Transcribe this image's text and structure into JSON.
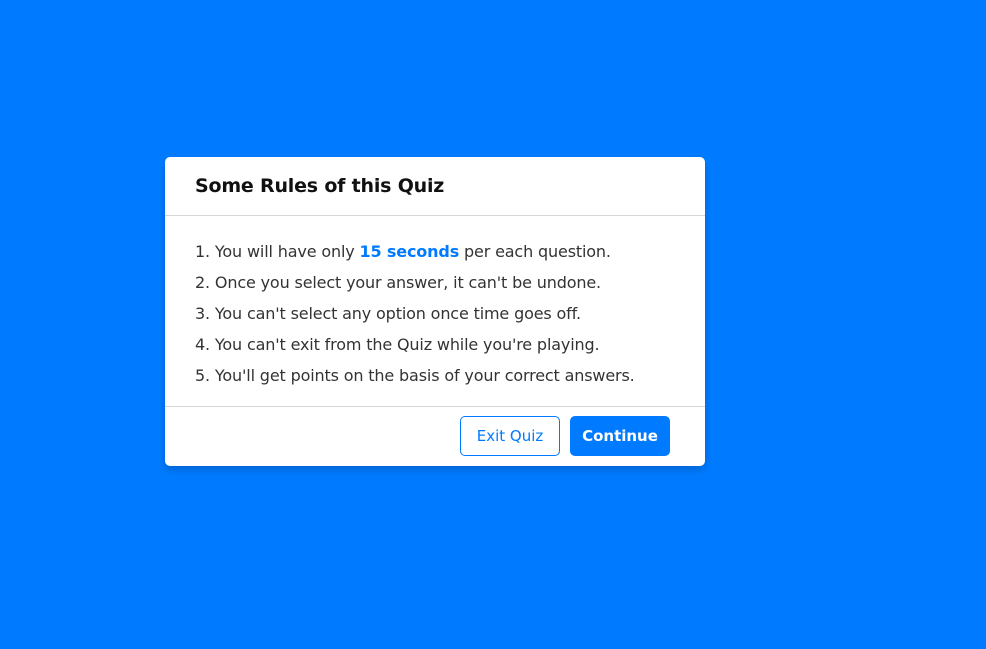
{
  "colors": {
    "background": "#007bff",
    "accent": "#007bff",
    "card": "#ffffff"
  },
  "info_box": {
    "title": "Some Rules of this Quiz",
    "rules": [
      {
        "number": "1.",
        "before": "You will have only ",
        "highlight": "15 seconds",
        "after": " per each question."
      },
      {
        "number": "2.",
        "text": "Once you select your answer, it can't be undone."
      },
      {
        "number": "3.",
        "text": "You can't select any option once time goes off."
      },
      {
        "number": "4.",
        "text": "You can't exit from the Quiz while you're playing."
      },
      {
        "number": "5.",
        "text": "You'll get points on the basis of your correct answers."
      }
    ],
    "buttons": {
      "exit_label": "Exit Quiz",
      "continue_label": "Continue"
    }
  }
}
